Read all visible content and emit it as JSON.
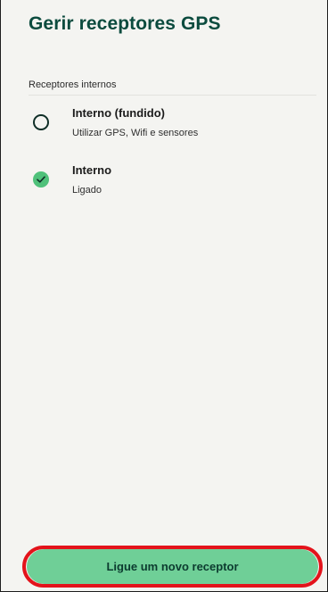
{
  "header": {
    "title": "Gerir receptores GPS"
  },
  "section": {
    "label": "Receptores internos"
  },
  "receivers": [
    {
      "title": "Interno (fundido)",
      "subtitle": "Utilizar GPS, Wifi e sensores",
      "selected": false
    },
    {
      "title": "Interno",
      "subtitle": "Ligado",
      "selected": true
    }
  ],
  "actions": {
    "connect_label": "Ligue um novo receptor"
  },
  "colors": {
    "title": "#0b4b3e",
    "accent": "#4fc17a",
    "button": "#6fcf97",
    "highlight_outline": "#e3131b",
    "background": "#f4f4f1"
  }
}
